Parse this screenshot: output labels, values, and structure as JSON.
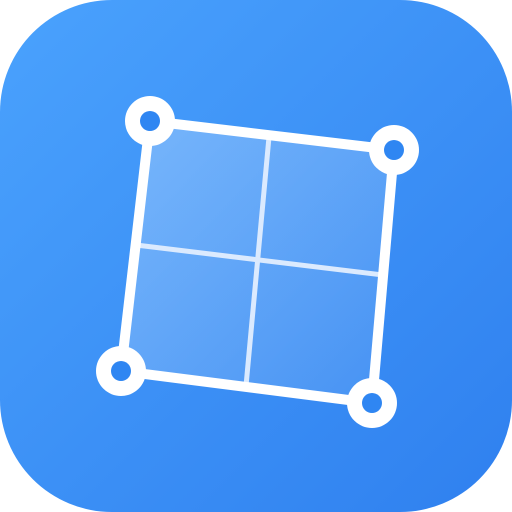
{
  "icon": {
    "name": "perspective-crop-app-icon",
    "colors": {
      "background_light": "#4aa2fd",
      "background_dark": "#2f80ef",
      "frame_stroke": "#ffffff",
      "grid_stroke": "#dbeafe",
      "handle_fill": "#ffffff",
      "handle_dot": "#2f86f2"
    }
  }
}
